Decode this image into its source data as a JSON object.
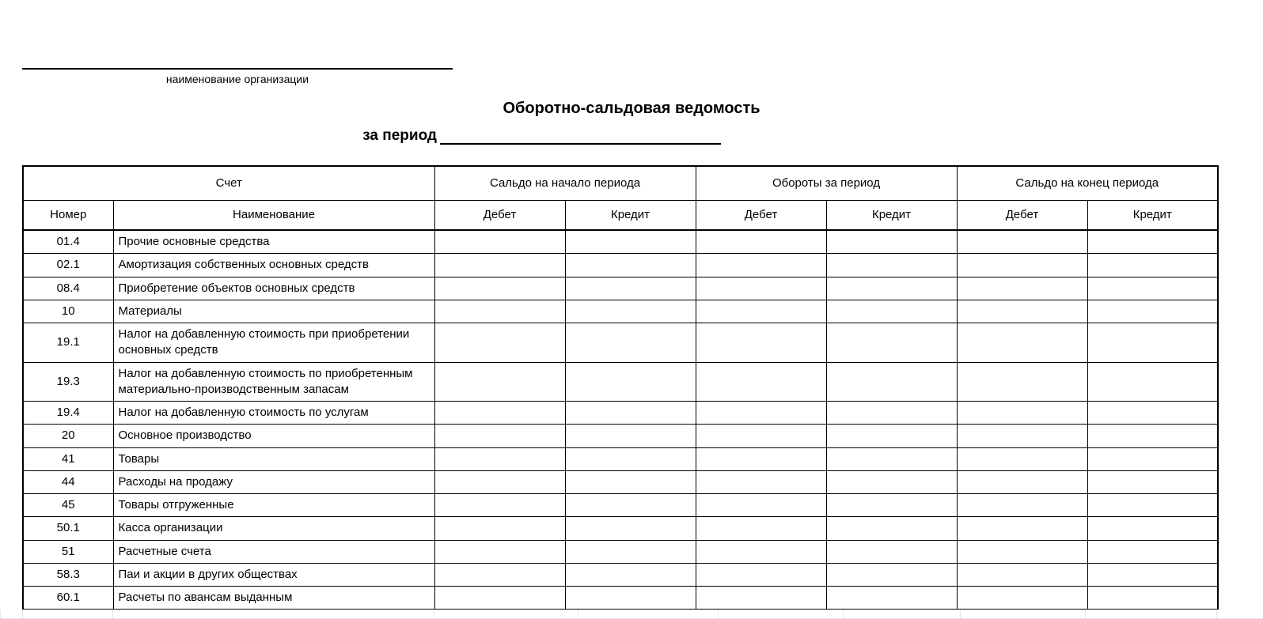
{
  "header": {
    "org_caption": "наименование организации",
    "title": "Оборотно-сальдовая ведомость",
    "period_label": "за период"
  },
  "table": {
    "group_headers": {
      "account": "Счет",
      "opening": "Сальдо на начало периода",
      "turnover": "Обороты за период",
      "closing": "Сальдо на конец периода"
    },
    "sub_headers": {
      "number": "Номер",
      "name": "Наименование",
      "debit": "Дебет",
      "credit": "Кредит"
    },
    "rows": [
      {
        "num": "01.4",
        "name": "Прочие основные средства",
        "v": [
          "",
          "",
          "",
          "",
          "",
          ""
        ]
      },
      {
        "num": "02.1",
        "name": "Амортизация собственных основных средств",
        "v": [
          "",
          "",
          "",
          "",
          "",
          ""
        ]
      },
      {
        "num": "08.4",
        "name": "Приобретение объектов основных средств",
        "v": [
          "",
          "",
          "",
          "",
          "",
          ""
        ]
      },
      {
        "num": "10",
        "name": "Материалы",
        "v": [
          "",
          "",
          "",
          "",
          "",
          ""
        ]
      },
      {
        "num": "19.1",
        "name": "Налог на добавленную  стоимость при приобретении основных средств",
        "v": [
          "",
          "",
          "",
          "",
          "",
          ""
        ]
      },
      {
        "num": "19.3",
        "name": "Налог на добавленную стоимость по приобретенным материально-производственным запасам",
        "v": [
          "",
          "",
          "",
          "",
          "",
          ""
        ]
      },
      {
        "num": "19.4",
        "name": "Налог на добавленную стоимость по услугам",
        "v": [
          "",
          "",
          "",
          "",
          "",
          ""
        ]
      },
      {
        "num": "20",
        "name": "Основное производство",
        "v": [
          "",
          "",
          "",
          "",
          "",
          ""
        ]
      },
      {
        "num": "41",
        "name": "Товары",
        "v": [
          "",
          "",
          "",
          "",
          "",
          ""
        ]
      },
      {
        "num": "44",
        "name": "Расходы на продажу",
        "v": [
          "",
          "",
          "",
          "",
          "",
          ""
        ]
      },
      {
        "num": "45",
        "name": "Товары отгруженные",
        "v": [
          "",
          "",
          "",
          "",
          "",
          ""
        ]
      },
      {
        "num": "50.1",
        "name": "Касса организации",
        "v": [
          "",
          "",
          "",
          "",
          "",
          ""
        ]
      },
      {
        "num": "51",
        "name": "Расчетные счета",
        "v": [
          "",
          "",
          "",
          "",
          "",
          ""
        ]
      },
      {
        "num": "58.3",
        "name": "Паи  и акции в других обществах",
        "v": [
          "",
          "",
          "",
          "",
          "",
          ""
        ]
      },
      {
        "num": "60.1",
        "name": "Расчеты по авансам выданным",
        "v": [
          "",
          "",
          "",
          "",
          "",
          ""
        ]
      }
    ]
  }
}
